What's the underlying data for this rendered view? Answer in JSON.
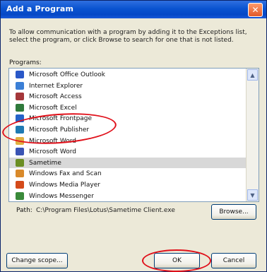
{
  "window": {
    "title": "Add a Program",
    "close_glyph": "✕"
  },
  "description": "To allow communication with a program by adding it to the Exceptions list, select the program, or click Browse to search for one that is not listed.",
  "programs_label": "Programs:",
  "programs": [
    {
      "label": "Microsoft Office Outlook",
      "icon": "outlook-icon",
      "color": "#2a58c8"
    },
    {
      "label": "Internet Explorer",
      "icon": "ie-icon",
      "color": "#3b7fd6"
    },
    {
      "label": "Microsoft Access",
      "icon": "access-icon",
      "color": "#a4373a"
    },
    {
      "label": "Microsoft Excel",
      "icon": "excel-icon",
      "color": "#2f7a3b"
    },
    {
      "label": "Microsoft Frontpage",
      "icon": "frontpage-icon",
      "color": "#2563c9"
    },
    {
      "label": "Microsoft Publisher",
      "icon": "publisher-icon",
      "color": "#1f7ab3"
    },
    {
      "label": "Microsoft Word",
      "icon": "word-icon",
      "color": "#e0b040"
    },
    {
      "label": "Microsoft Word",
      "icon": "word-icon",
      "color": "#3a54b4"
    },
    {
      "label": "Sametime",
      "icon": "sametime-icon",
      "color": "#6b8e23",
      "selected": true
    },
    {
      "label": "Windows Fax and Scan",
      "icon": "fax-icon",
      "color": "#d98a2b"
    },
    {
      "label": "Windows Media Player",
      "icon": "media-player-icon",
      "color": "#d44a1a"
    },
    {
      "label": "Windows Messenger",
      "icon": "messenger-icon",
      "color": "#3a8a3a"
    }
  ],
  "path_label": "Path:",
  "path_value": "C:\\Program Files\\Lotus\\Sametime Client.exe",
  "buttons": {
    "browse": "Browse...",
    "change_scope": "Change scope...",
    "ok": "OK",
    "cancel": "Cancel"
  },
  "scrollbar": {
    "up": "▲",
    "down": "▼"
  }
}
